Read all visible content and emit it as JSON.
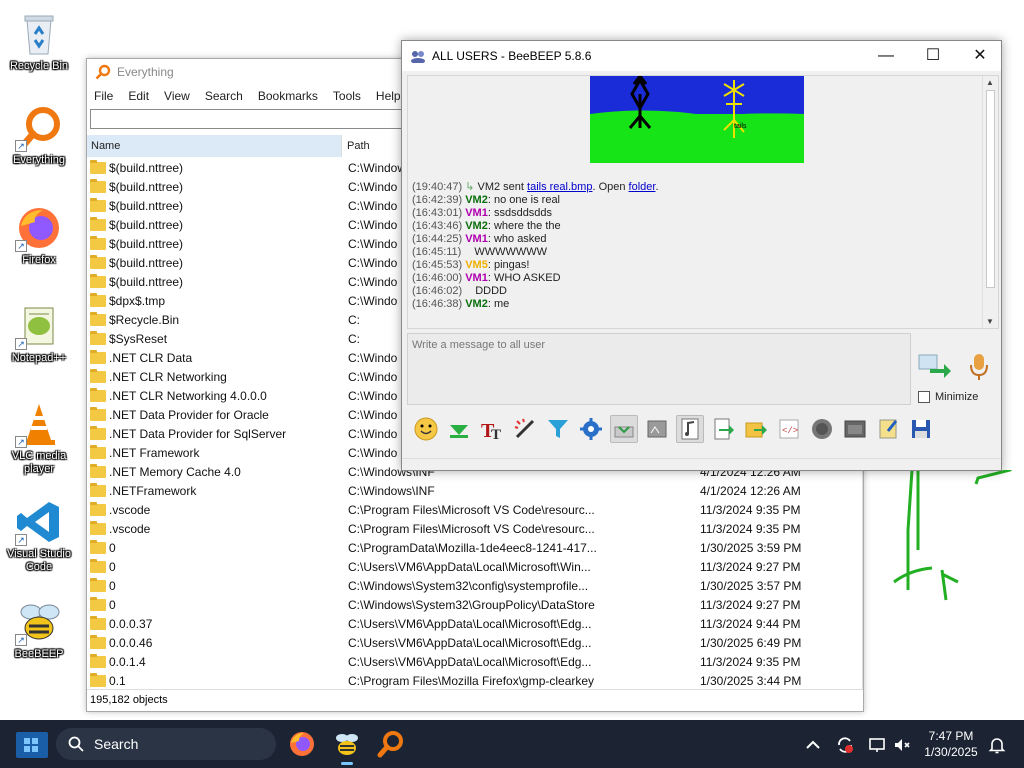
{
  "desktop": {
    "icons": [
      {
        "label": "Recycle Bin"
      },
      {
        "label": "Everything"
      },
      {
        "label": "Firefox"
      },
      {
        "label": "Notepad++"
      },
      {
        "label": "VLC media player"
      },
      {
        "label": "Visual Studio Code"
      },
      {
        "label": "BeeBEEP"
      }
    ]
  },
  "everything": {
    "title": "Everything",
    "menu": [
      "File",
      "Edit",
      "View",
      "Search",
      "Bookmarks",
      "Tools",
      "Help"
    ],
    "search_value": "",
    "columns": {
      "name": "Name",
      "path": "Path"
    },
    "rows": [
      {
        "name": "$(build.nttree)",
        "path": "C:\\Windows",
        "date": ""
      },
      {
        "name": "$(build.nttree)",
        "path": "C:\\Windo",
        "date": ""
      },
      {
        "name": "$(build.nttree)",
        "path": "C:\\Windo",
        "date": ""
      },
      {
        "name": "$(build.nttree)",
        "path": "C:\\Windo",
        "date": ""
      },
      {
        "name": "$(build.nttree)",
        "path": "C:\\Windo",
        "date": ""
      },
      {
        "name": "$(build.nttree)",
        "path": "C:\\Windo",
        "date": ""
      },
      {
        "name": "$(build.nttree)",
        "path": "C:\\Windo",
        "date": ""
      },
      {
        "name": "$dpx$.tmp",
        "path": "C:\\Windo",
        "date": ""
      },
      {
        "name": "$Recycle.Bin",
        "path": "C:",
        "date": ""
      },
      {
        "name": "$SysReset",
        "path": "C:",
        "date": ""
      },
      {
        "name": ".NET CLR Data",
        "path": "C:\\Windo",
        "date": ""
      },
      {
        "name": ".NET CLR Networking",
        "path": "C:\\Windo",
        "date": ""
      },
      {
        "name": ".NET CLR Networking 4.0.0.0",
        "path": "C:\\Windo",
        "date": ""
      },
      {
        "name": ".NET Data Provider for Oracle",
        "path": "C:\\Windo",
        "date": ""
      },
      {
        "name": ".NET Data Provider for SqlServer",
        "path": "C:\\Windo",
        "date": ""
      },
      {
        "name": ".NET Framework",
        "path": "C:\\Windo",
        "date": ""
      },
      {
        "name": ".NET Memory Cache 4.0",
        "path": "C:\\Windows\\INF",
        "date": "4/1/2024 12:26 AM"
      },
      {
        "name": ".NETFramework",
        "path": "C:\\Windows\\INF",
        "date": "4/1/2024 12:26 AM"
      },
      {
        "name": ".vscode",
        "path": "C:\\Program Files\\Microsoft VS Code\\resourc...",
        "date": "11/3/2024 9:35 PM"
      },
      {
        "name": ".vscode",
        "path": "C:\\Program Files\\Microsoft VS Code\\resourc...",
        "date": "11/3/2024 9:35 PM"
      },
      {
        "name": "0",
        "path": "C:\\ProgramData\\Mozilla-1de4eec8-1241-417...",
        "date": "1/30/2025 3:59 PM"
      },
      {
        "name": "0",
        "path": "C:\\Users\\VM6\\AppData\\Local\\Microsoft\\Win...",
        "date": "11/3/2024 9:27 PM"
      },
      {
        "name": "0",
        "path": "C:\\Windows\\System32\\config\\systemprofile...",
        "date": "1/30/2025 3:57 PM"
      },
      {
        "name": "0",
        "path": "C:\\Windows\\System32\\GroupPolicy\\DataStore",
        "date": "11/3/2024 9:27 PM"
      },
      {
        "name": "0.0.0.37",
        "path": "C:\\Users\\VM6\\AppData\\Local\\Microsoft\\Edg...",
        "date": "11/3/2024 9:44 PM"
      },
      {
        "name": "0.0.0.46",
        "path": "C:\\Users\\VM6\\AppData\\Local\\Microsoft\\Edg...",
        "date": "1/30/2025 6:49 PM"
      },
      {
        "name": "0.0.1.4",
        "path": "C:\\Users\\VM6\\AppData\\Local\\Microsoft\\Edg...",
        "date": "11/3/2024 9:35 PM"
      },
      {
        "name": "0.1",
        "path": "C:\\Program Files\\Mozilla Firefox\\gmp-clearkey",
        "date": "1/30/2025 3:44 PM"
      }
    ],
    "status": "195,182 objects"
  },
  "beebeep": {
    "title": "ALL USERS - BeeBEEP 5.8.6",
    "messages": [
      {
        "ts": "(19:40:47)",
        "pre": "VM2 sent ",
        "link1": "tails real.bmp",
        "mid": ". Open ",
        "link2": "folder",
        "post": "."
      },
      {
        "ts": "(16:42:39)",
        "user": "VM2",
        "cls": "u2",
        "text": ": no one is real"
      },
      {
        "ts": "(16:43:01)",
        "user": "VM1",
        "cls": "u1",
        "text": ": ssdsddsdds"
      },
      {
        "ts": "(16:43:46)",
        "user": "VM2",
        "cls": "u2",
        "text": ": where the the"
      },
      {
        "ts": "(16:44:25)",
        "user": "VM1",
        "cls": "u1",
        "text": ": who asked"
      },
      {
        "ts": "(16:45:11)",
        "user": "",
        "cls": "",
        "text": "WWWWWWW"
      },
      {
        "ts": "(16:45:53)",
        "user": "VM5",
        "cls": "u5",
        "text": ": pingas!"
      },
      {
        "ts": "(16:46:00)",
        "user": "VM1",
        "cls": "u1",
        "text": ": WHO ASKED"
      },
      {
        "ts": "(16:46:02)",
        "user": "",
        "cls": "",
        "text": "DDDD"
      },
      {
        "ts": "(16:46:38)",
        "user": "VM2",
        "cls": "u2",
        "text": ": me"
      }
    ],
    "image_label": "tails",
    "input_placeholder": "Write a message to all user",
    "minimize_label": "Minimize"
  },
  "taskbar": {
    "search_label": "Search",
    "time": "7:47 PM",
    "date": "1/30/2025"
  }
}
